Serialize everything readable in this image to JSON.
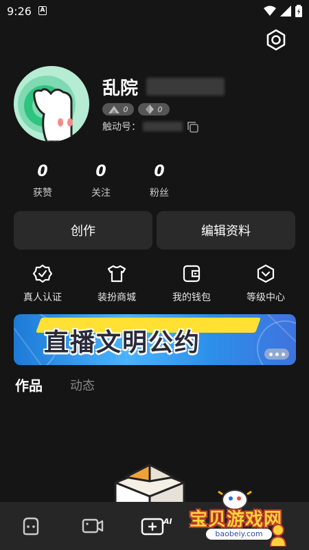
{
  "status_bar": {
    "time": "9:26",
    "notification_badge": "A"
  },
  "profile": {
    "nickname": "乱院",
    "badges": [
      {
        "icon": "mountain-icon",
        "count": "0"
      },
      {
        "icon": "diamond-icon",
        "count": "0"
      }
    ],
    "id_label": "触动号："
  },
  "stats": [
    {
      "value": "0",
      "label": "获赞"
    },
    {
      "value": "0",
      "label": "关注"
    },
    {
      "value": "0",
      "label": "粉丝"
    }
  ],
  "actions": {
    "create": "创作",
    "edit_profile": "编辑资料"
  },
  "shortcuts": [
    {
      "icon": "verified-badge-icon",
      "label": "真人认证"
    },
    {
      "icon": "tshirt-icon",
      "label": "装扮商城"
    },
    {
      "icon": "wallet-icon",
      "label": "我的钱包"
    },
    {
      "icon": "level-shield-icon",
      "label": "等级中心"
    }
  ],
  "banner": {
    "title": "直播文明公约"
  },
  "tabs": [
    {
      "label": "作品",
      "active": true
    },
    {
      "label": "动态",
      "active": false
    }
  ],
  "bottom_nav": [
    {
      "icon": "home-face-icon"
    },
    {
      "icon": "video-camera-icon"
    },
    {
      "icon": "ai-create-icon",
      "text": "AI"
    }
  ],
  "watermark": {
    "text": "宝贝游戏网",
    "url": "baobeiy.com"
  },
  "colors": {
    "background": "#151515",
    "card": "#2a2a2a",
    "nav": "#262626",
    "avatar": "#9be3c3"
  }
}
